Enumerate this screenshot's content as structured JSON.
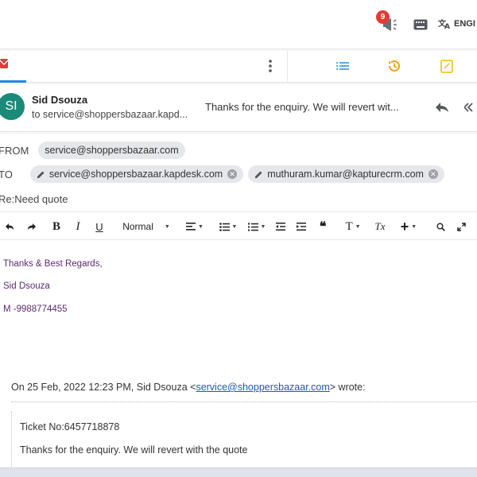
{
  "topbar": {
    "notification_count": "9",
    "language_label": "ENGI"
  },
  "mail": {
    "avatar_initials": "SI",
    "sender_name": "Sid Dsouza",
    "to_line": "to service@shoppersbazaar.kapd...",
    "snippet": "Thanks for the enquiry. We will revert wit..."
  },
  "compose": {
    "from_label": "FROM",
    "from_chip": "service@shoppersbazaar.com",
    "to_label": "TO",
    "to_chips": [
      "service@shoppersbazaar.kapdesk.com",
      "muthuram.kumar@kapturecrm.com"
    ],
    "subject": "Re:Need quote"
  },
  "toolbar": {
    "bold": "B",
    "italic": "I",
    "underline": "U",
    "format_select": "Normal",
    "quote": "❝",
    "text_size": "T",
    "clear_format": "Tx",
    "insert": "+"
  },
  "body": {
    "lines": [
      "Thanks & Best Regards,",
      "Sid Dsouza",
      "M -9988774455"
    ],
    "quote_prefix": "On 25 Feb, 2022 12:23 PM, Sid Dsouza <",
    "quote_email": "service@shoppersbazaar.com",
    "quote_suffix": "> wrote:",
    "quoted_lines": [
      "Ticket No:6457718878",
      "Thanks for the enquiry. We will revert with the quote"
    ]
  },
  "colors": {
    "accent": "#1e88e5",
    "avatar": "#1b8a78",
    "badge": "#e53935",
    "signature_text": "#5b2a6e",
    "link": "#1a56c8"
  },
  "icons": {
    "notification": "megaphone-icon",
    "keyboard": "keyboard-icon",
    "language": "translate-icon",
    "reply": "reply-icon",
    "reply_all": "reply-all-icon"
  }
}
